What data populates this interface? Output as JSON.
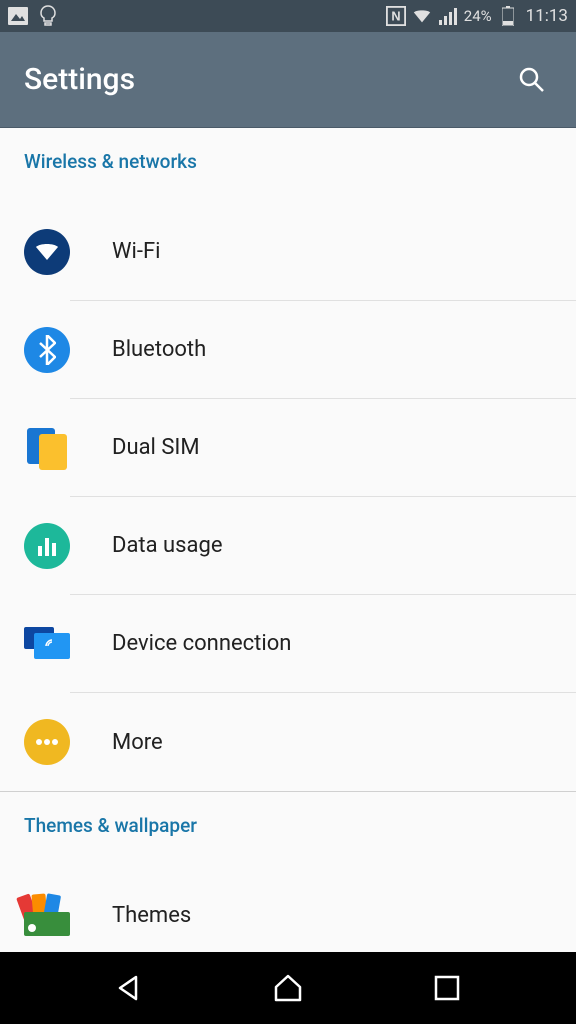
{
  "status_bar": {
    "battery_percent": "24%",
    "time": "11:13"
  },
  "app_bar": {
    "title": "Settings"
  },
  "sections": [
    {
      "header": "Wireless & networks",
      "items": [
        {
          "label": "Wi-Fi"
        },
        {
          "label": "Bluetooth"
        },
        {
          "label": "Dual SIM"
        },
        {
          "label": "Data usage"
        },
        {
          "label": "Device connection"
        },
        {
          "label": "More"
        }
      ]
    },
    {
      "header": "Themes & wallpaper",
      "items": [
        {
          "label": "Themes"
        }
      ]
    }
  ]
}
